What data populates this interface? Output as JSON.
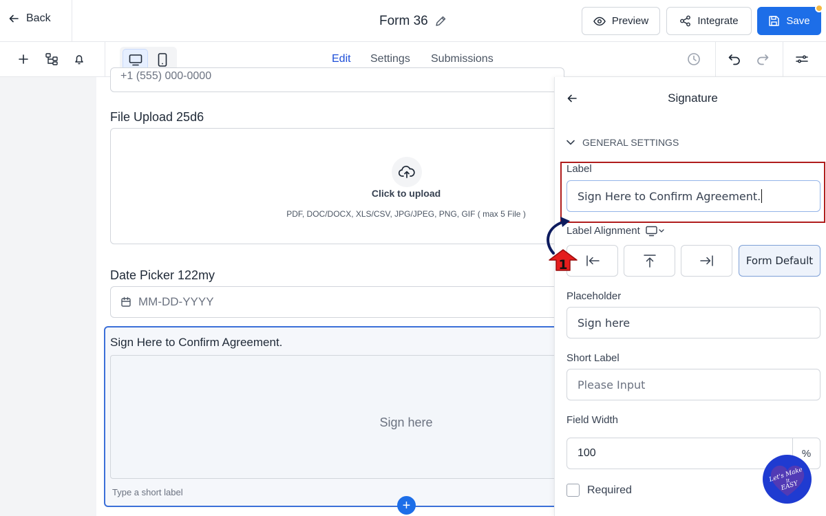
{
  "topbar": {
    "back_label": "Back",
    "form_title": "Form 36",
    "preview_label": "Preview",
    "integrate_label": "Integrate",
    "save_label": "Save"
  },
  "subbar": {
    "tabs": [
      {
        "label": "Edit",
        "active": true
      },
      {
        "label": "Settings",
        "active": false
      },
      {
        "label": "Submissions",
        "active": false
      }
    ],
    "device_active": "desktop"
  },
  "form": {
    "phone_placeholder": "+1 (555) 000-0000",
    "file_upload_label": "File Upload 25d6",
    "upload_cta": "Click to upload",
    "upload_types": "PDF, DOC/DOCX, XLS/CSV, JPG/JPEG, PNG, GIF ( max 5 File )",
    "date_label": "Date Picker 122my",
    "date_placeholder": "MM-DD-YYYY",
    "signature_label": "Sign Here to Confirm Agreement.",
    "signature_pad_text": "Sign here",
    "short_label_hint": "Type a short label",
    "add_symbol": "+"
  },
  "panel": {
    "title": "Signature",
    "section_header": "General Settings",
    "label_title": "Label",
    "label_value": "Sign Here to Confirm Agreement.",
    "alignment_title": "Label Alignment",
    "alignment_options": [
      "left",
      "top",
      "right",
      "Form Default"
    ],
    "alignment_selected": "Form Default",
    "placeholder_title": "Placeholder",
    "placeholder_value": "Sign here",
    "short_label_title": "Short Label",
    "short_label_placeholder": "Please Input",
    "field_width_title": "Field Width",
    "field_width_value": "100",
    "field_width_unit": "%",
    "required_label": "Required",
    "required_checked": false
  },
  "annotation": {
    "step_number": "1",
    "highlight_color": "#b01c1c"
  },
  "watermark": {
    "text": "Let's Make It EASY"
  },
  "colors": {
    "primary": "#1d6ee8",
    "active_tab": "#1d4ed8",
    "notification": "#f5b942"
  }
}
